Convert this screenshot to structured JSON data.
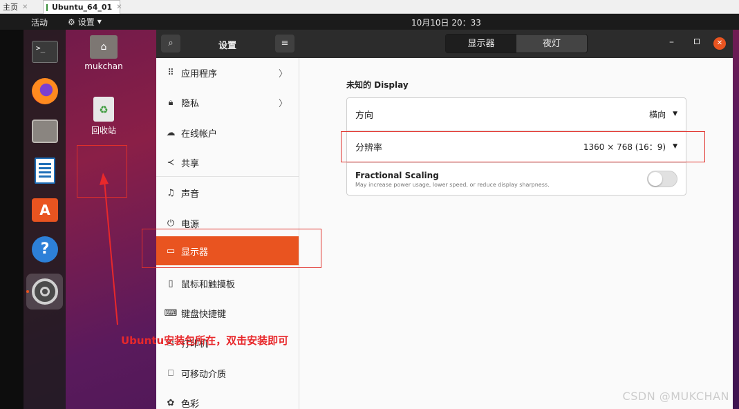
{
  "vm_tabs": {
    "home": "主页",
    "vm": "Ubuntu_64_01"
  },
  "topbar": {
    "activities": "活动",
    "app_menu": "设置",
    "clock": "10月10日 20：33"
  },
  "desktop": {
    "home_folder": "mukchan",
    "trash": "回收站"
  },
  "window": {
    "title": "设置",
    "tabs": [
      {
        "label": "显示器",
        "selected": true
      },
      {
        "label": "夜灯",
        "selected": false
      }
    ],
    "sidebar": [
      {
        "label": "应用程序",
        "icon": "apps-grid-icon",
        "arrow": true
      },
      {
        "label": "隐私",
        "icon": "lock-icon",
        "arrow": true
      },
      {
        "label": "在线帐户",
        "icon": "cloud-icon"
      },
      {
        "label": "共享",
        "icon": "share-icon"
      },
      {
        "label": "声音",
        "icon": "music-note-icon"
      },
      {
        "label": "电源",
        "icon": "power-icon"
      },
      {
        "label": "显示器",
        "icon": "display-icon",
        "active": true
      },
      {
        "label": "鼠标和触摸板",
        "icon": "mouse-icon"
      },
      {
        "label": "键盘快捷键",
        "icon": "keyboard-icon"
      },
      {
        "label": "打印机",
        "icon": "printer-icon"
      },
      {
        "label": "可移动介质",
        "icon": "removable-media-icon"
      },
      {
        "label": "色彩",
        "icon": "color-icon"
      }
    ]
  },
  "display": {
    "section_title": "未知的 Display",
    "orientation": {
      "label": "方向",
      "value": "横向"
    },
    "resolution": {
      "label": "分辨率",
      "value": "1360 × 768 (16：9)"
    },
    "fractional": {
      "label": "Fractional Scaling",
      "desc": "May increase power usage, lower speed, or reduce display sharpness.",
      "enabled": false
    }
  },
  "annotation": "Ubuntu安装包所在，双击安装即可",
  "watermark": "CSDN @MUKCHAN",
  "colors": {
    "accent": "#e95420",
    "annotation": "#e8282b"
  }
}
